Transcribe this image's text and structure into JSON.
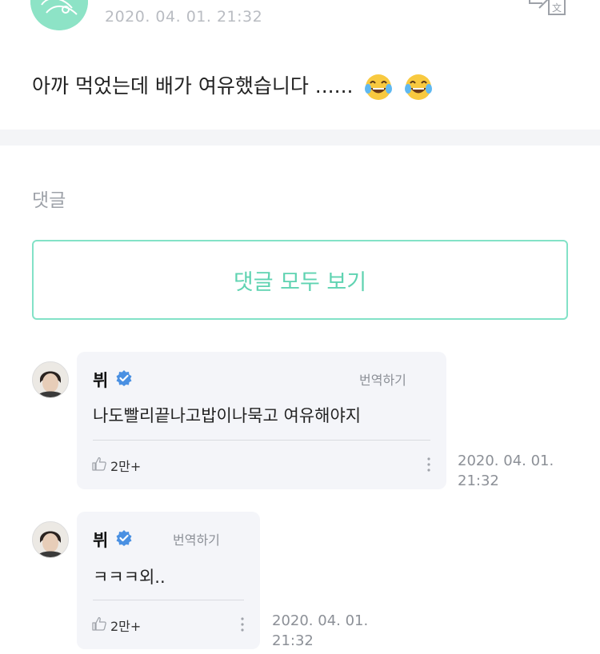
{
  "post": {
    "time": "2020. 04. 01. 21:32",
    "text": "아까 먹었는데 배가 여유했습니다 ......",
    "emoji": [
      "face-with-tears-of-joy",
      "face-with-tears-of-joy"
    ]
  },
  "comments_section": {
    "title": "댓글",
    "view_all_label": "댓글 모두 보기"
  },
  "comments": [
    {
      "author": "뷔",
      "verified": true,
      "translate_label": "번역하기",
      "text": "나도빨리끝나고밥이나묵고 여유해야지",
      "likes": "2만+",
      "time_date": "2020. 04. 01.",
      "time_clock": "21:32"
    },
    {
      "author": "뷔",
      "verified": true,
      "translate_label": "번역하기",
      "text": "ㅋㅋㅋ외..",
      "likes": "2만+",
      "time_date": "2020. 04. 01.",
      "time_clock": "21:32"
    }
  ],
  "colors": {
    "accent": "#5fd3b1",
    "verified": "#4a90e2",
    "bubble": "#f4f5f9"
  }
}
